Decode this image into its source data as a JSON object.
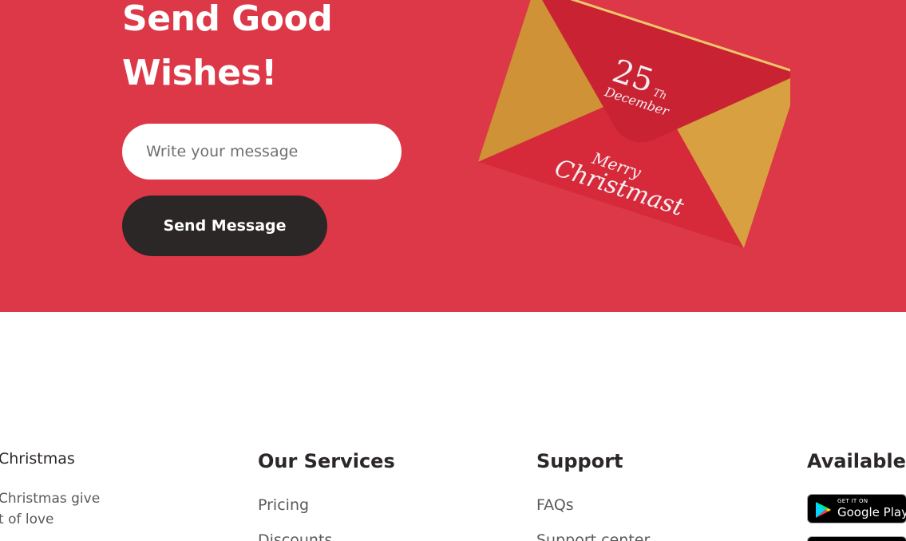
{
  "hero": {
    "title_line1": "Send Good",
    "title_line2": "Wishes!",
    "input_placeholder": "Write your message",
    "send_button": "Send Message",
    "envelope": {
      "day": "25",
      "suffix": "Th",
      "month": "December",
      "greeting_line1": "Merry",
      "greeting_line2": "Christmast"
    },
    "colors": {
      "background": "#dc3847",
      "button": "#2b2726",
      "envelope_red": "#cf2637",
      "envelope_gold": "#d39638"
    }
  },
  "footer": {
    "about": {
      "title": "Christmas",
      "text_line1": "Christmas give",
      "text_line2": "t of love"
    },
    "services": {
      "title": "Our Services",
      "links": [
        "Pricing",
        "Discounts"
      ]
    },
    "support": {
      "title": "Support",
      "links": [
        "FAQs",
        "Support center"
      ]
    },
    "available": {
      "title": "Available",
      "google_play_small": "GET IT ON",
      "google_play_big": "Google Play"
    }
  }
}
